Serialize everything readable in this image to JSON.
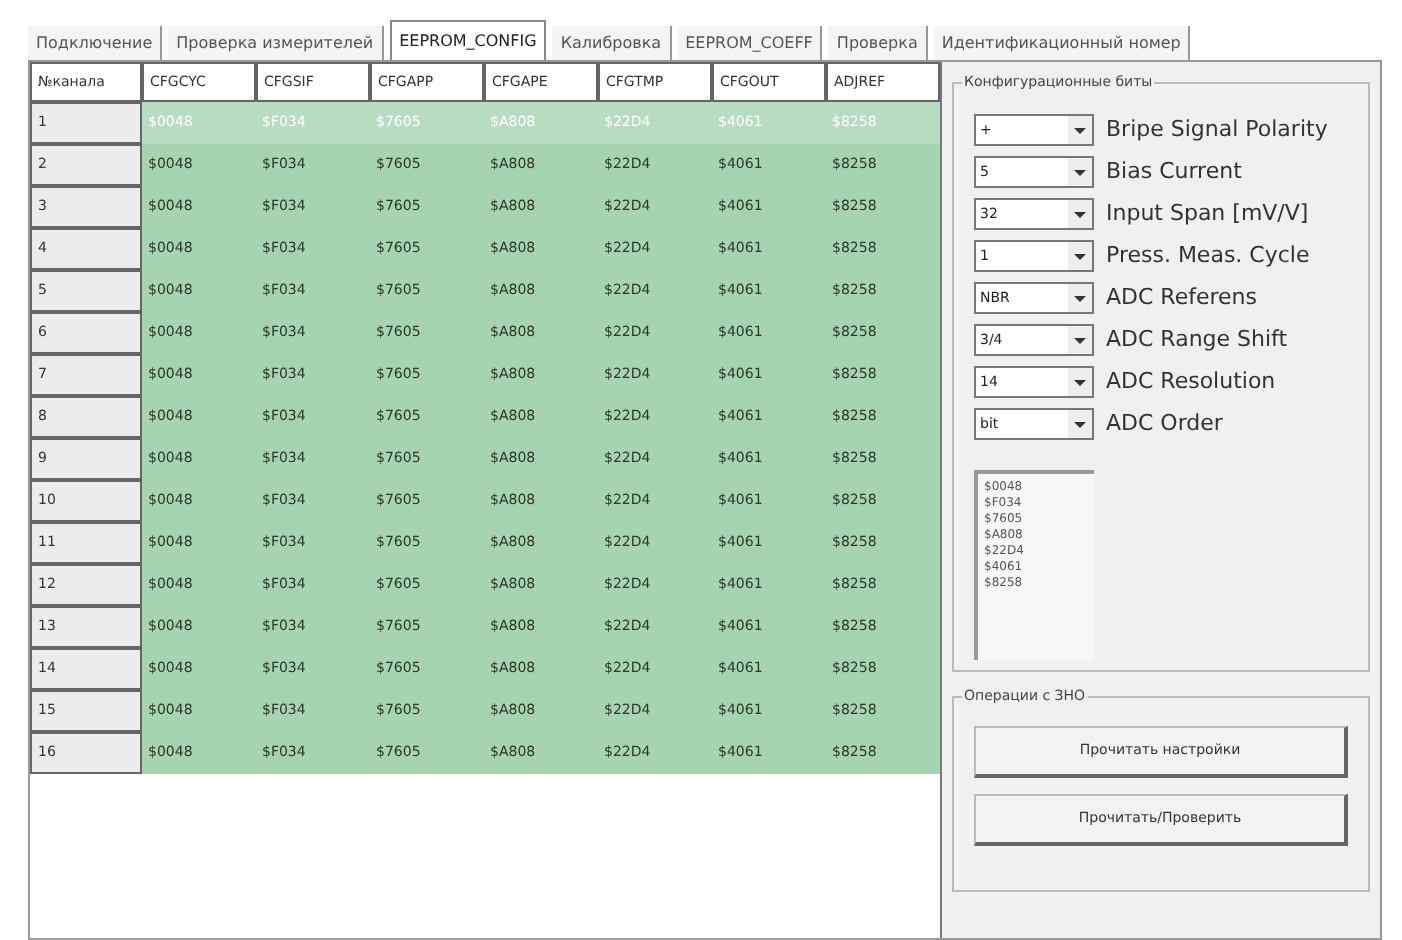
{
  "tabs": [
    {
      "label": "Подключение",
      "selected": false
    },
    {
      "label": "Проверка измерителей",
      "selected": false
    },
    {
      "label": "EEPROM_CONFIG",
      "selected": true
    },
    {
      "label": "Калибровка",
      "selected": false
    },
    {
      "label": "EEPROM_COEFF",
      "selected": false
    },
    {
      "label": "Проверка",
      "selected": false
    },
    {
      "label": "Идентификационный номер",
      "selected": false
    }
  ],
  "table": {
    "columns": [
      "№канала",
      "CFGCYC",
      "CFGSIF",
      "CFGAPP",
      "CFGAPE",
      "CFGTMP",
      "CFGOUT",
      "ADJREF"
    ],
    "rows": [
      {
        "selected": true,
        "cells": [
          "1",
          "$0048",
          "$F034",
          "$7605",
          "$A808",
          "$22D4",
          "$4061",
          "$8258"
        ]
      },
      {
        "selected": false,
        "cells": [
          "2",
          "$0048",
          "$F034",
          "$7605",
          "$A808",
          "$22D4",
          "$4061",
          "$8258"
        ]
      },
      {
        "selected": false,
        "cells": [
          "3",
          "$0048",
          "$F034",
          "$7605",
          "$A808",
          "$22D4",
          "$4061",
          "$8258"
        ]
      },
      {
        "selected": false,
        "cells": [
          "4",
          "$0048",
          "$F034",
          "$7605",
          "$A808",
          "$22D4",
          "$4061",
          "$8258"
        ]
      },
      {
        "selected": false,
        "cells": [
          "5",
          "$0048",
          "$F034",
          "$7605",
          "$A808",
          "$22D4",
          "$4061",
          "$8258"
        ]
      },
      {
        "selected": false,
        "cells": [
          "6",
          "$0048",
          "$F034",
          "$7605",
          "$A808",
          "$22D4",
          "$4061",
          "$8258"
        ]
      },
      {
        "selected": false,
        "cells": [
          "7",
          "$0048",
          "$F034",
          "$7605",
          "$A808",
          "$22D4",
          "$4061",
          "$8258"
        ]
      },
      {
        "selected": false,
        "cells": [
          "8",
          "$0048",
          "$F034",
          "$7605",
          "$A808",
          "$22D4",
          "$4061",
          "$8258"
        ]
      },
      {
        "selected": false,
        "cells": [
          "9",
          "$0048",
          "$F034",
          "$7605",
          "$A808",
          "$22D4",
          "$4061",
          "$8258"
        ]
      },
      {
        "selected": false,
        "cells": [
          "10",
          "$0048",
          "$F034",
          "$7605",
          "$A808",
          "$22D4",
          "$4061",
          "$8258"
        ]
      },
      {
        "selected": false,
        "cells": [
          "11",
          "$0048",
          "$F034",
          "$7605",
          "$A808",
          "$22D4",
          "$4061",
          "$8258"
        ]
      },
      {
        "selected": false,
        "cells": [
          "12",
          "$0048",
          "$F034",
          "$7605",
          "$A808",
          "$22D4",
          "$4061",
          "$8258"
        ]
      },
      {
        "selected": false,
        "cells": [
          "13",
          "$0048",
          "$F034",
          "$7605",
          "$A808",
          "$22D4",
          "$4061",
          "$8258"
        ]
      },
      {
        "selected": false,
        "cells": [
          "14",
          "$0048",
          "$F034",
          "$7605",
          "$A808",
          "$22D4",
          "$4061",
          "$8258"
        ]
      },
      {
        "selected": false,
        "cells": [
          "15",
          "$0048",
          "$F034",
          "$7605",
          "$A808",
          "$22D4",
          "$4061",
          "$8258"
        ]
      },
      {
        "selected": false,
        "cells": [
          "16",
          "$0048",
          "$F034",
          "$7605",
          "$A808",
          "$22D4",
          "$4061",
          "$8258"
        ]
      }
    ]
  },
  "config_bits": {
    "title": "Конфигурационные биты",
    "settings": [
      {
        "value": "+",
        "label": "Bripe Signal Polarity"
      },
      {
        "value": "5",
        "label": "Bias Current"
      },
      {
        "value": "32",
        "label": "Input Span [mV/V]"
      },
      {
        "value": "1",
        "label": "Press. Meas. Cycle"
      },
      {
        "value": "NBR",
        "label": "ADC Referens"
      },
      {
        "value": "3/4",
        "label": "ADC Range Shift"
      },
      {
        "value": "14",
        "label": "ADC Resolution"
      },
      {
        "value": "bit",
        "label": "ADC Order"
      }
    ],
    "register_list": [
      "$0048",
      "$F034",
      "$7605",
      "$A808",
      "$22D4",
      "$4061",
      "$8258"
    ]
  },
  "operations": {
    "title": "Операции с ЗНО",
    "buttons": [
      "Прочитать настройки",
      "Прочитать/Проверить"
    ]
  }
}
